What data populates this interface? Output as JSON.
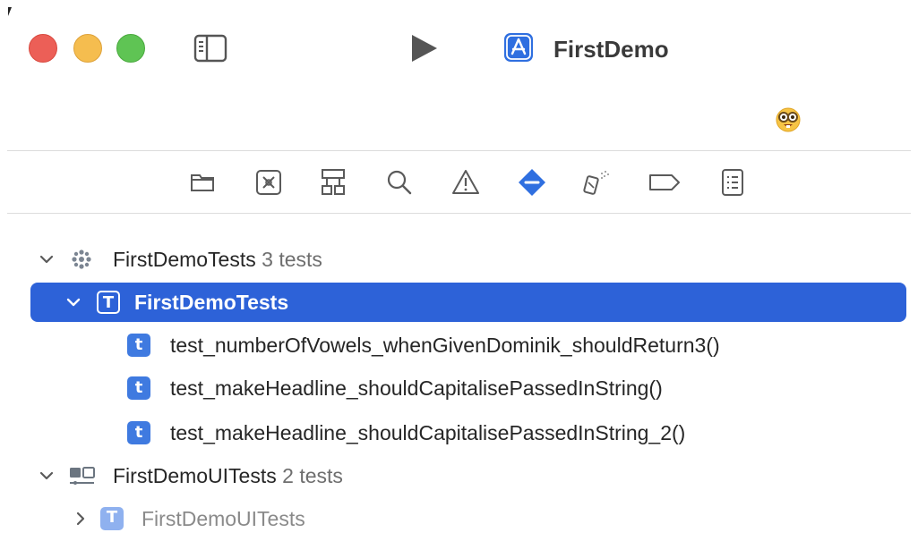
{
  "titlebar": {
    "scheme_title": "FirstDemo"
  },
  "navigator_tabs": [
    {
      "icon": "folder-icon"
    },
    {
      "icon": "source-control-icon"
    },
    {
      "icon": "hierarchy-icon"
    },
    {
      "icon": "search-icon"
    },
    {
      "icon": "warning-icon"
    },
    {
      "icon": "test-navigator-icon",
      "selected": true
    },
    {
      "icon": "debug-icon"
    },
    {
      "icon": "breakpoint-icon"
    },
    {
      "icon": "report-icon"
    }
  ],
  "tree": {
    "group1": {
      "name": "FirstDemoTests",
      "count": "3 tests"
    },
    "class1": {
      "name": "FirstDemoTests",
      "badge": "T"
    },
    "tests": [
      {
        "badge": "t",
        "name": "test_numberOfVowels_whenGivenDominik_shouldReturn3()"
      },
      {
        "badge": "t",
        "name": "test_makeHeadline_shouldCapitalisePassedInString()"
      },
      {
        "badge": "t",
        "name": "test_makeHeadline_shouldCapitalisePassedInString_2()"
      }
    ],
    "group2": {
      "name": "FirstDemoUITests",
      "count": "2 tests"
    },
    "class2": {
      "name": "FirstDemoUITests",
      "badge": "T"
    }
  },
  "colors": {
    "selection": "#2d62d8",
    "accent": "#2f6fe0",
    "close": "#ec5f57",
    "minimize": "#f5bd4f",
    "maximize": "#5fc454"
  }
}
